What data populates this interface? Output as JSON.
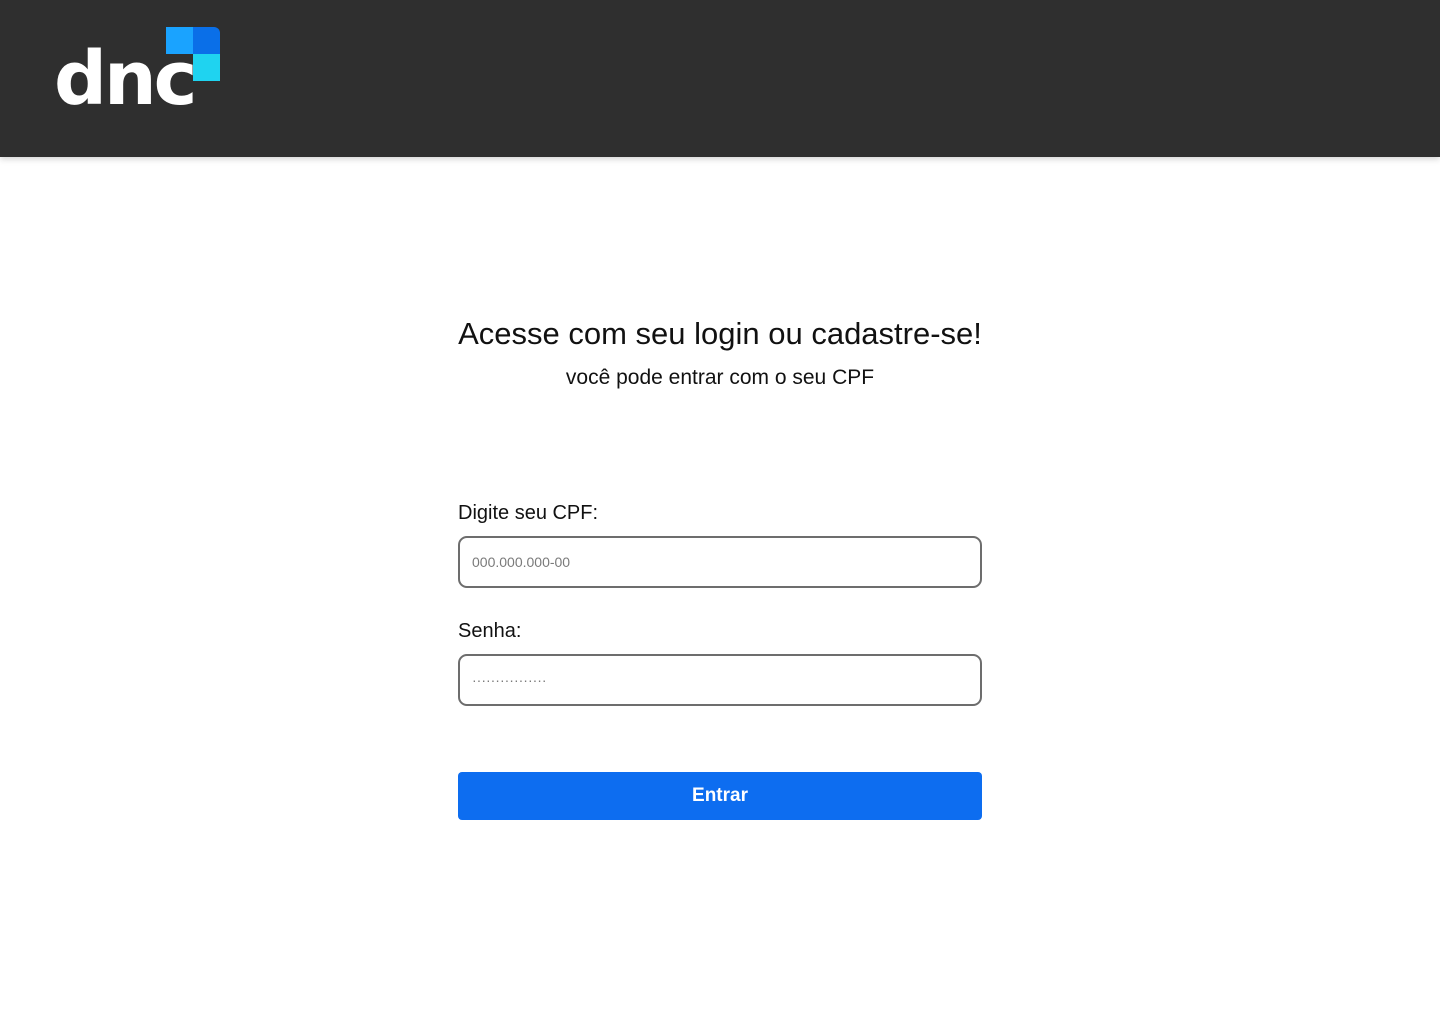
{
  "header": {
    "logo": {
      "text": "dnc",
      "colors": {
        "square_top_left": "#1aa3ff",
        "square_top_right": "#0a6fe8",
        "square_bottom_right": "#1fd3f0"
      }
    },
    "background": "#2f2f2f"
  },
  "login": {
    "title": "Acesse com seu login ou cadastre-se!",
    "subtitle": "você pode entrar com o seu CPF",
    "cpf_label": "Digite seu CPF:",
    "cpf_placeholder": "000.000.000-00",
    "password_label": "Senha:",
    "password_placeholder": "················",
    "submit_label": "Entrar",
    "accent_color": "#0d6df0"
  }
}
